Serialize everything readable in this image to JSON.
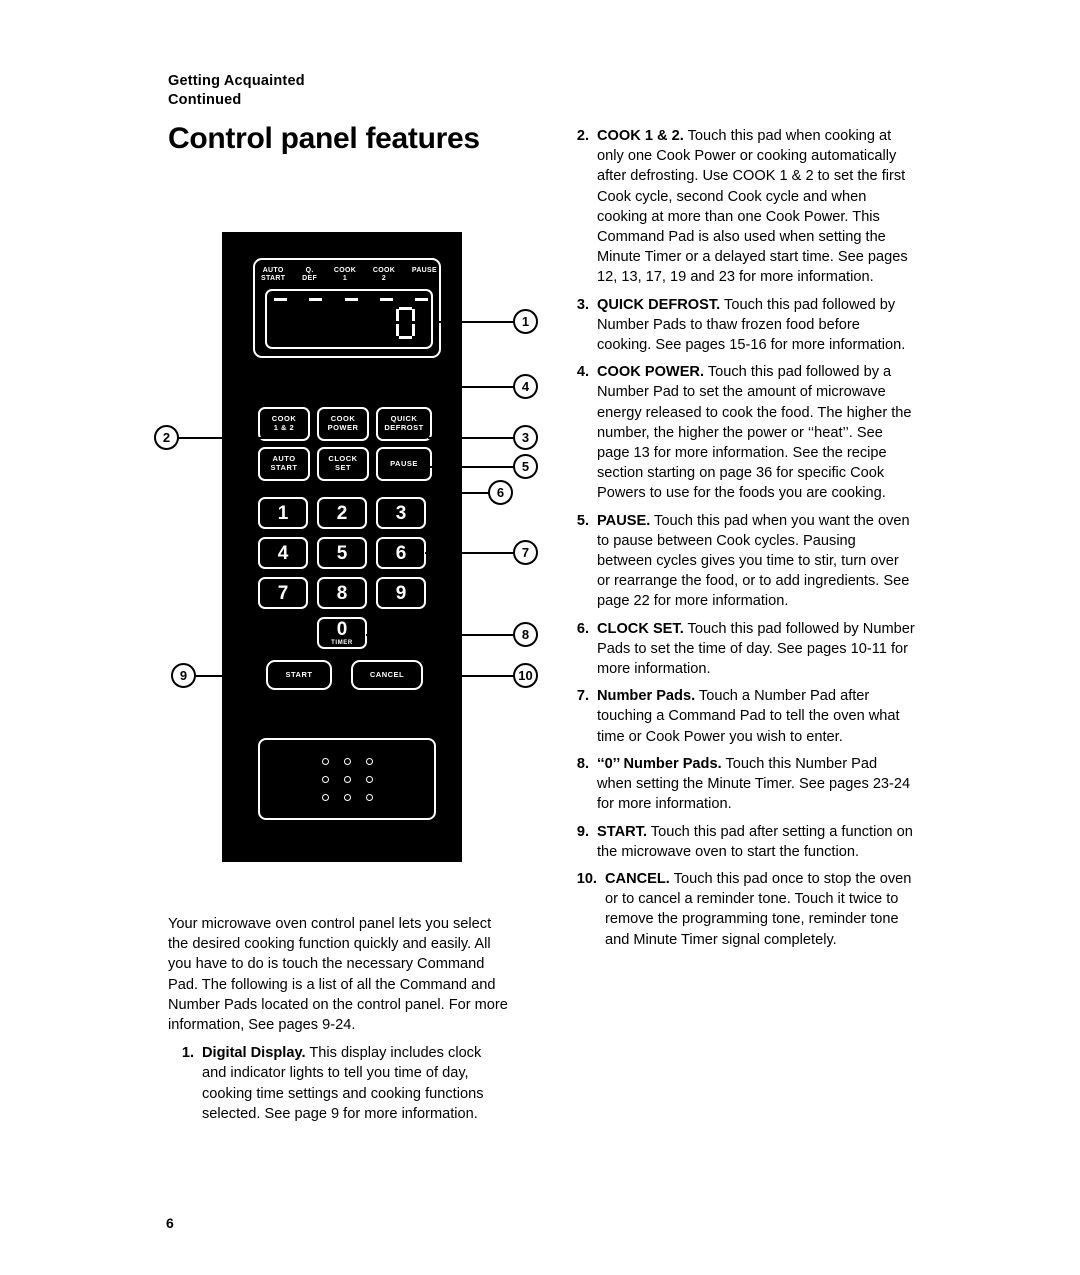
{
  "header": {
    "kicker_line1": "Getting Acquainted",
    "kicker_line2": "Continued",
    "title": "Control panel features"
  },
  "page_number": "6",
  "left_column": {
    "intro": "Your microwave oven control panel lets you select the desired cooking function quickly and easily. All you have to do is touch the necessary Command Pad. The following is a list of all the Command and Number Pads located on the control panel. For more information, See pages 9-24.",
    "items": [
      {
        "num": "1.",
        "lead": "Digital Display.",
        "body": " This display includes clock and indicator lights to tell you time of day, cooking time settings and cooking functions selected. See page 9 for more information."
      }
    ]
  },
  "right_column": {
    "items": [
      {
        "num": "2.",
        "lead": "COOK 1 & 2.",
        "body": " Touch this pad when cooking at only one Cook Power or cooking automatically after defrosting. Use COOK 1 & 2 to set the first Cook cycle, second Cook cycle and when cooking at more than one Cook Power. This Command Pad is also used when setting the Minute Timer or a delayed start time. See pages 12, 13, 17, 19 and 23 for more information."
      },
      {
        "num": "3.",
        "lead": "QUICK DEFROST.",
        "body": " Touch this pad followed by Number Pads to thaw frozen food before cooking. See pages 15-16 for more information."
      },
      {
        "num": "4.",
        "lead": "COOK POWER.",
        "body": " Touch this pad followed by a Number Pad to set the amount of microwave energy released to cook the food. The higher the number, the higher the power or ‘‘heat’’. See page 13 for more information. See the recipe section starting on page 36 for specific Cook Powers to use for the foods you are cooking."
      },
      {
        "num": "5.",
        "lead": "PAUSE.",
        "body": " Touch this pad when you want the oven to pause between Cook cycles. Pausing between cycles gives you time to stir, turn over or rearrange the food, or to add ingredients. See page 22 for more information."
      },
      {
        "num": "6.",
        "lead": "CLOCK SET.",
        "body": " Touch this pad followed by Number Pads to set the time of day. See pages 10-11 for more information."
      },
      {
        "num": "7.",
        "lead": "Number Pads.",
        "body": " Touch a Number Pad after touching a Command Pad to tell the oven what time or Cook Power you wish to enter."
      },
      {
        "num": "8.",
        "lead": "‘‘0’’ Number Pads.",
        "body": " Touch this Number Pad when setting the Minute Timer. See pages 23-24 for more information."
      },
      {
        "num": "9.",
        "lead": "START.",
        "body": " Touch this pad after setting a function on the microwave oven to start the function."
      },
      {
        "num": "10.",
        "lead": "CANCEL.",
        "body": " Touch this pad once to stop the oven or to cancel a reminder tone. Touch it twice to remove the programming tone, reminder tone and Minute Timer signal completely."
      }
    ]
  },
  "control_panel": {
    "display_indicators": [
      {
        "line1": "AUTO",
        "line2": "START"
      },
      {
        "line1": "Q.",
        "line2": "DEF"
      },
      {
        "line1": "COOK",
        "line2": "1"
      },
      {
        "line1": "COOK",
        "line2": "2"
      },
      {
        "line1": "PAUSE",
        "line2": ""
      }
    ],
    "command_pads": [
      {
        "line1": "COOK",
        "line2": "1 & 2"
      },
      {
        "line1": "COOK",
        "line2": "POWER"
      },
      {
        "line1": "QUICK",
        "line2": "DEFROST"
      },
      {
        "line1": "AUTO",
        "line2": "START"
      },
      {
        "line1": "CLOCK",
        "line2": "SET"
      },
      {
        "line1": "PAUSE",
        "line2": ""
      }
    ],
    "number_pads": [
      "1",
      "2",
      "3",
      "4",
      "5",
      "6",
      "7",
      "8",
      "9"
    ],
    "zero_pad": {
      "digit": "0",
      "sublabel": "TIMER"
    },
    "action_pads": [
      {
        "label": "START"
      },
      {
        "label": "CANCEL"
      }
    ],
    "callouts": [
      "1",
      "2",
      "3",
      "4",
      "5",
      "6",
      "7",
      "8",
      "9",
      "10"
    ]
  }
}
